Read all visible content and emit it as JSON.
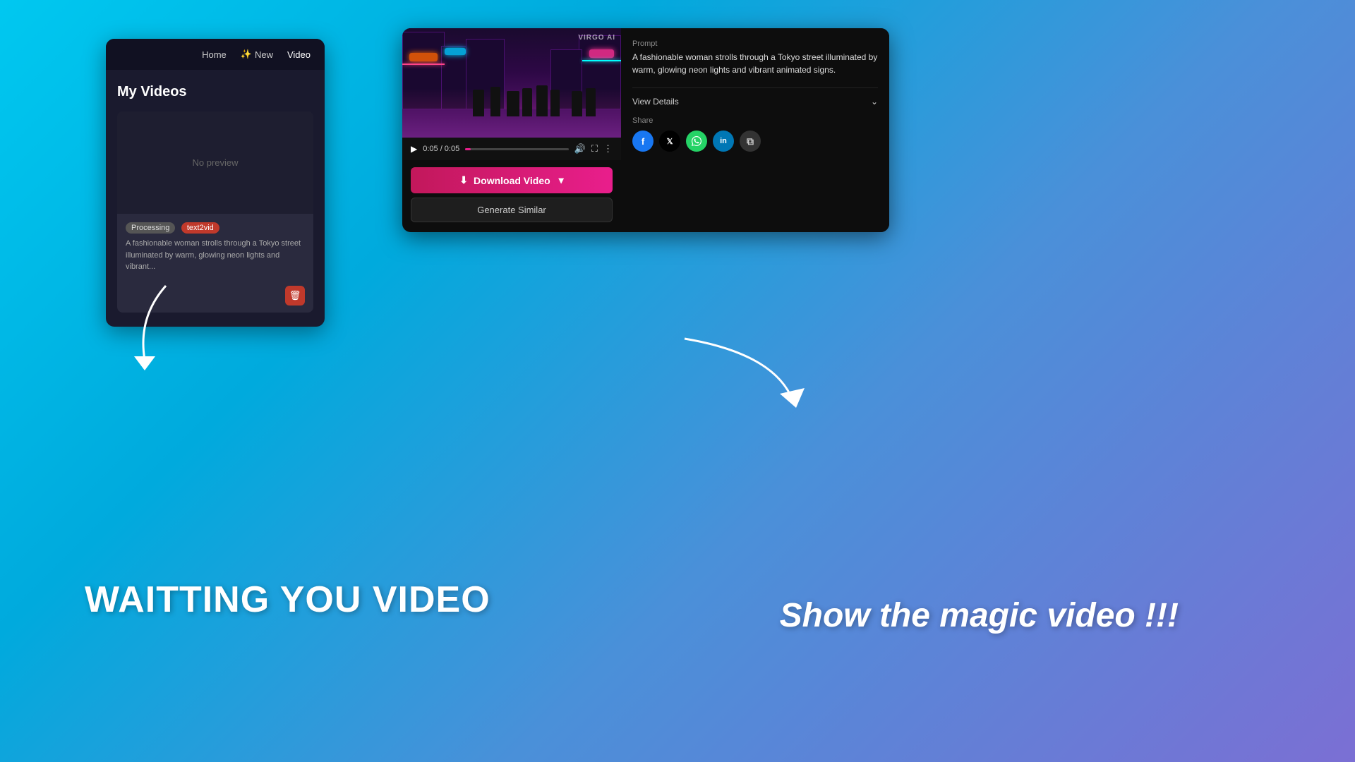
{
  "page": {
    "background": "gradient-cyan-to-purple"
  },
  "nav": {
    "items": [
      "Home",
      "New",
      "Video"
    ],
    "new_icon": "✨"
  },
  "left_panel": {
    "title": "My Videos",
    "video_card": {
      "preview_text": "No preview",
      "status_badge": "Processing",
      "type_badge": "text2vid",
      "description": "A fashionable woman strolls through a Tokyo street illuminated by warm, glowing neon lights and vibrant...",
      "delete_icon": "🗑"
    }
  },
  "right_panel": {
    "prompt_label": "Prompt",
    "prompt_text": "A fashionable woman strolls through a Tokyo street illuminated by warm, glowing neon lights and vibrant animated signs.",
    "view_details_label": "View Details",
    "watermark": "VIRGO AI",
    "video_time": "0:05 / 0:05",
    "share_label": "Share",
    "download_btn_label": "Download Video",
    "generate_similar_label": "Generate Similar",
    "chevron_down": "⌄"
  },
  "annotations": {
    "left_label": "WAITTING YOU VIDEO",
    "right_label": "Show the magic video !!!"
  }
}
